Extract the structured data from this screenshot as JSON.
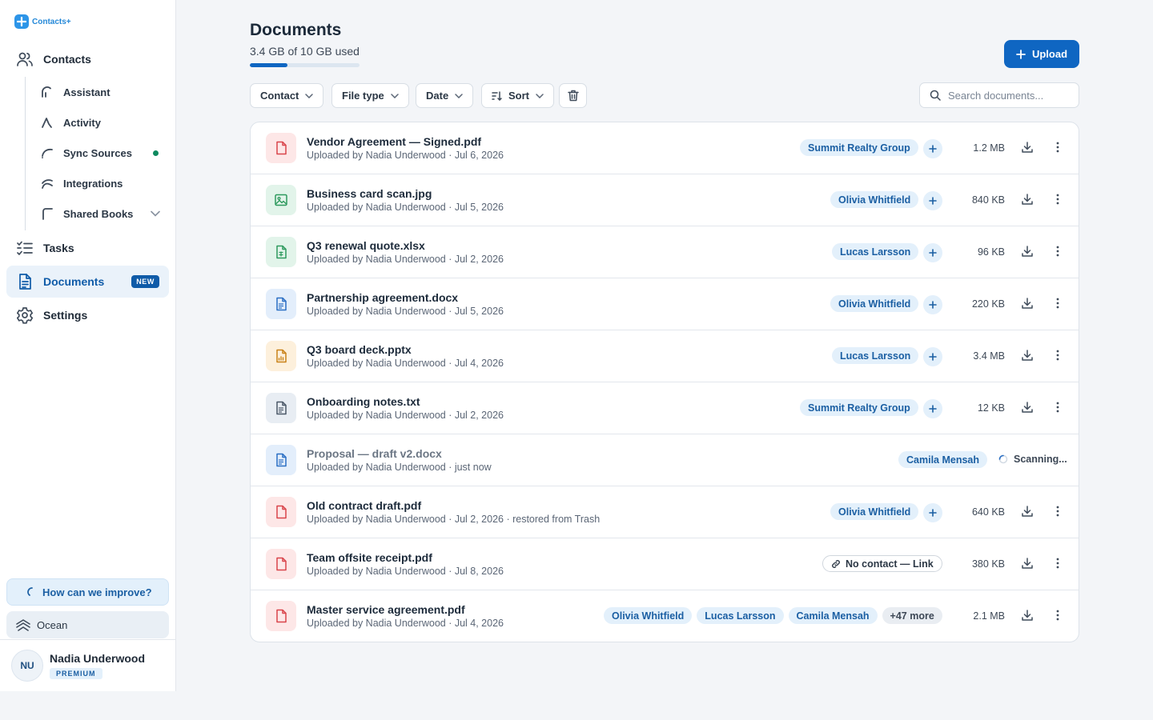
{
  "app": {
    "logo_text": "Contacts+"
  },
  "sidebar": {
    "contacts_label": "Contacts",
    "subitems": [
      "Assistant",
      "Activity",
      "Sync Sources",
      "Integrations",
      "Shared Books"
    ],
    "tasks_label": "Tasks",
    "documents_label": "Documents",
    "documents_badge": "NEW",
    "settings_label": "Settings",
    "improve_label": "How can we improve?",
    "theme_label": "Ocean"
  },
  "user": {
    "initials": "NU",
    "name": "Nadia Underwood",
    "plan": "PREMIUM"
  },
  "header": {
    "title": "Documents",
    "storage_text": "3.4 GB of 10 GB used",
    "storage_used_fraction": 0.34,
    "upload_label": "Upload"
  },
  "filters": {
    "contact": "Contact",
    "file_type": "File type",
    "date": "Date",
    "sort": "Sort"
  },
  "search": {
    "placeholder": "Search documents..."
  },
  "colors": {
    "accent": "#0f66c2",
    "chip_bg": "#e3f0fb",
    "chip_text": "#1b5fa3",
    "dot_green": "#0e8a5f"
  },
  "documents": [
    {
      "name": "Vendor Agreement — Signed.pdf",
      "meta": "Uploaded by Nadia Underwood · Jul 6, 2026",
      "kind": "pdf",
      "tags": [
        "Summit Realty Group"
      ],
      "size": "1.2 MB"
    },
    {
      "name": "Business card scan.jpg",
      "meta": "Uploaded by Nadia Underwood · Jul 5, 2026",
      "kind": "image",
      "tags": [
        "Olivia Whitfield"
      ],
      "size": "840 KB"
    },
    {
      "name": "Q3 renewal quote.xlsx",
      "meta": "Uploaded by Nadia Underwood · Jul 2, 2026",
      "kind": "sheet",
      "tags": [
        "Lucas Larsson"
      ],
      "size": "96 KB"
    },
    {
      "name": "Partnership agreement.docx",
      "meta": "Uploaded by Nadia Underwood · Jul 5, 2026",
      "kind": "doc",
      "tags": [
        "Olivia Whitfield"
      ],
      "size": "220 KB"
    },
    {
      "name": "Q3 board deck.pptx",
      "meta": "Uploaded by Nadia Underwood · Jul 4, 2026",
      "kind": "slides",
      "tags": [
        "Lucas Larsson"
      ],
      "size": "3.4 MB"
    },
    {
      "name": "Onboarding notes.txt",
      "meta": "Uploaded by Nadia Underwood · Jul 2, 2026",
      "kind": "text",
      "tags": [
        "Summit Realty Group"
      ],
      "size": "12 KB"
    },
    {
      "name": "Proposal — draft v2.docx",
      "meta": "Uploaded by Nadia Underwood · just now",
      "kind": "doc",
      "tags": [
        "Camila Mensah"
      ],
      "status": "Scanning..."
    },
    {
      "name": "Old contract draft.pdf",
      "meta": "Uploaded by Nadia Underwood · Jul 2, 2026 · restored from Trash",
      "kind": "pdf",
      "tags": [
        "Olivia Whitfield"
      ],
      "size": "640 KB"
    },
    {
      "name": "Team offsite receipt.pdf",
      "meta": "Uploaded by Nadia Underwood · Jul 8, 2026",
      "kind": "pdf",
      "no_contact": "No contact — Link",
      "size": "380 KB"
    },
    {
      "name": "Master service agreement.pdf",
      "meta": "Uploaded by Nadia Underwood · Jul 4, 2026",
      "kind": "pdf",
      "tags": [
        "Olivia Whitfield",
        "Lucas Larsson",
        "Camila Mensah"
      ],
      "more": "+47 more",
      "size": "2.1 MB"
    }
  ]
}
